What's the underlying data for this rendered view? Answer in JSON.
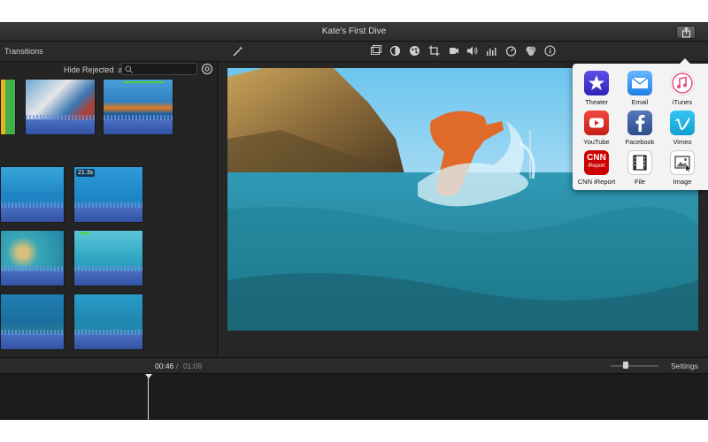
{
  "window": {
    "title": "Kate's First Dive"
  },
  "browser": {
    "tab_label": "Transitions",
    "filter_value": "Hide Rejected",
    "search_placeholder": "",
    "clip_duration_label": "21.3s"
  },
  "timeline": {
    "current_time": "00:46",
    "separator": "/",
    "total_time": "01:09",
    "settings_label": "Settings",
    "zoom_level": 0.3
  },
  "share_menu": {
    "items": [
      {
        "label": "Theater",
        "icon": "theater-icon",
        "color": "#3b3bd6"
      },
      {
        "label": "Email",
        "icon": "email-icon",
        "color": "#2a8ff0"
      },
      {
        "label": "iTunes",
        "icon": "itunes-icon",
        "color": "#e84a86"
      },
      {
        "label": "YouTube",
        "icon": "youtube-icon",
        "color": "#e52d27"
      },
      {
        "label": "Facebook",
        "icon": "facebook-icon",
        "color": "#3b5998"
      },
      {
        "label": "Vimeo",
        "icon": "vimeo-icon",
        "color": "#1ab7ea"
      },
      {
        "label": "CNN iReport",
        "icon": "cnn-ireport-icon",
        "color": "#cc0000"
      },
      {
        "label": "File",
        "icon": "file-icon",
        "color": "#ffffff"
      },
      {
        "label": "Image",
        "icon": "image-icon",
        "color": "#ffffff"
      }
    ],
    "cnn_logo_text": "CNN",
    "cnn_sub_text": "iReport"
  },
  "colors": {
    "accent_blue": "#3f65c0",
    "clip_selection_green": "#4ed13a"
  }
}
